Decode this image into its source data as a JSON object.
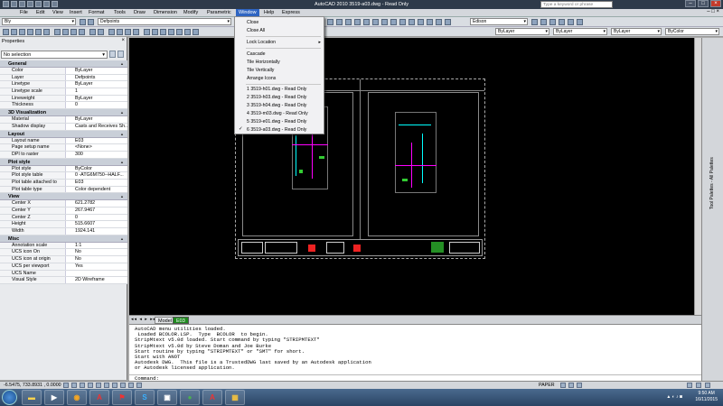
{
  "window": {
    "title": "AutoCAD 2010     3519-a03.dwg - Read Only",
    "search_placeholder": "Type a keyword or phrase"
  },
  "menu": {
    "items": [
      "File",
      "Edit",
      "View",
      "Insert",
      "Format",
      "Tools",
      "Draw",
      "Dimension",
      "Modify",
      "Parametric",
      "Window",
      "Help",
      "Express"
    ],
    "active": "Window"
  },
  "toolbar": {
    "workspace": "Bly",
    "layer_combo": "Defpoints",
    "text_style": "Edison",
    "color_combo": "ByLayer",
    "linetype_combo": "ByLayer",
    "lineweight_combo": "ByLayer",
    "plotstyle_combo": "ByColor"
  },
  "window_menu": {
    "items": [
      {
        "label": "Close"
      },
      {
        "label": "Close All"
      },
      {
        "label": "Lock Location",
        "submenu": true
      },
      {
        "label": "Cascade"
      },
      {
        "label": "Tile Horizontally"
      },
      {
        "label": "Tile Vertically"
      },
      {
        "label": "Arrange Icons"
      },
      {
        "label": "1 3519-h01.dwg - Read Only"
      },
      {
        "label": "2 3519-h03.dwg - Read Only"
      },
      {
        "label": "3 3519-h04.dwg - Read Only"
      },
      {
        "label": "4 3519-m03.dwg - Read Only"
      },
      {
        "label": "5 3519-e01.dwg - Read Only"
      },
      {
        "label": "6 3519-a03.dwg - Read Only",
        "checked": true
      }
    ]
  },
  "properties": {
    "title": "Properties",
    "selection": "No selection",
    "sections": [
      {
        "name": "General",
        "rows": [
          {
            "k": "Color",
            "v": "ByLayer"
          },
          {
            "k": "Layer",
            "v": "Defpoints"
          },
          {
            "k": "Linetype",
            "v": "ByLayer"
          },
          {
            "k": "Linetype scale",
            "v": "1"
          },
          {
            "k": "Lineweight",
            "v": "ByLayer"
          },
          {
            "k": "Thickness",
            "v": "0"
          }
        ]
      },
      {
        "name": "3D Visualization",
        "rows": [
          {
            "k": "Material",
            "v": "ByLayer"
          },
          {
            "k": "Shadow display",
            "v": "Casts and Receives Sh..."
          }
        ]
      },
      {
        "name": "Layout",
        "rows": [
          {
            "k": "Layout name",
            "v": "E03"
          },
          {
            "k": "Page setup name",
            "v": "<None>"
          },
          {
            "k": "DPI to raster",
            "v": "300"
          }
        ]
      },
      {
        "name": "Plot style",
        "rows": [
          {
            "k": "Plot style",
            "v": "ByColor"
          },
          {
            "k": "Plot style table",
            "v": "0 -ATG6M750--HALF..."
          },
          {
            "k": "Plot table attached to",
            "v": "E03"
          },
          {
            "k": "Plot table type",
            "v": "Color dependent"
          }
        ]
      },
      {
        "name": "View",
        "rows": [
          {
            "k": "Center X",
            "v": "621.2782"
          },
          {
            "k": "Center Y",
            "v": "267.9467"
          },
          {
            "k": "Center Z",
            "v": "0"
          },
          {
            "k": "Height",
            "v": "515.6607"
          },
          {
            "k": "Width",
            "v": "1924.141"
          }
        ]
      },
      {
        "name": "Misc",
        "rows": [
          {
            "k": "Annotation scale",
            "v": "1:1"
          },
          {
            "k": "UCS icon On",
            "v": "No"
          },
          {
            "k": "UCS icon at origin",
            "v": "No"
          },
          {
            "k": "UCS per viewport",
            "v": "Yes"
          },
          {
            "k": "UCS Name",
            "v": ""
          },
          {
            "k": "Visual Style",
            "v": "2D Wireframe"
          }
        ]
      }
    ]
  },
  "tabs": {
    "model": "Model",
    "layout": "E03"
  },
  "command": {
    "lines": [
      "AutoCAD menu utilities loaded.",
      " Loaded BCOLOR.LSP.  Type  BCOLOR  to begin.",
      "StripMtext v5.0d loaded. Start command by typing \"STRIPMTEXT\"",
      "StripMtext v5.0d by Steve Doman and Joe Burke",
      "Start routine by typing \"STRIPMTEXT\" or \"SMT\" for short.",
      "Start with ANOT",
      "Autodesk DWG.  This file is a TrustedDWG last saved by an Autodesk application",
      "or Autodesk licensed application."
    ],
    "prompt": "Command:"
  },
  "status": {
    "coords": "-6.5475, 733.8931 , 0.0000",
    "paper": "PAPER",
    "time": "9:50 AM",
    "date": "16/11/2015"
  },
  "palette": {
    "label": "Tool Palettes - All Palettes"
  },
  "colors": {
    "accent": "#2f65c2",
    "cyan": "#00ffff",
    "magenta": "#ff00ff",
    "green": "#33cc33"
  }
}
